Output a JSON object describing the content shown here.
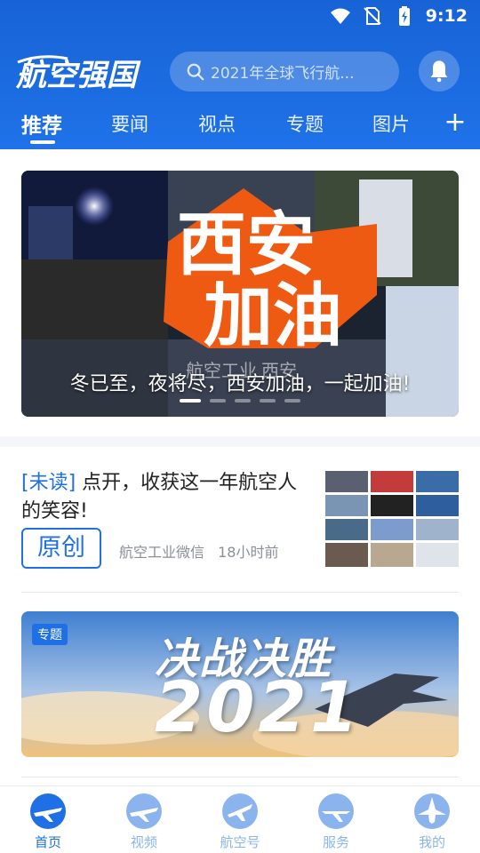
{
  "status_bar": {
    "time": "9:12"
  },
  "header": {
    "logo_text": "航空强国",
    "search_placeholder": "2021年全球飞行航...",
    "tabs": [
      {
        "label": "推荐",
        "active": true
      },
      {
        "label": "要闻"
      },
      {
        "label": "视点"
      },
      {
        "label": "专题"
      },
      {
        "label": "图片"
      }
    ],
    "add_tab": "+"
  },
  "banner": {
    "headline_line1": "西安",
    "headline_line2": "加油",
    "watermark": "航空工业 西安",
    "caption": "冬已至，夜将尽，西安加油，一起加油!",
    "slide_count": 5,
    "active_slide": 1
  },
  "article": {
    "unread_tag": "[未读]",
    "title": "点开，收获这一年航空人的笑容!",
    "badge": "原创",
    "source": "航空工业微信",
    "time": "18小时前"
  },
  "special": {
    "tag": "专题",
    "title": "决战决胜",
    "year": "2021"
  },
  "bottom_nav": [
    {
      "label": "首页",
      "active": true
    },
    {
      "label": "视频"
    },
    {
      "label": "航空号"
    },
    {
      "label": "服务"
    },
    {
      "label": "我的"
    }
  ],
  "colors": {
    "brand_blue": "#1f6fe5",
    "header_blue": "#1763d6",
    "nav_inactive": "#8bb4ee"
  }
}
